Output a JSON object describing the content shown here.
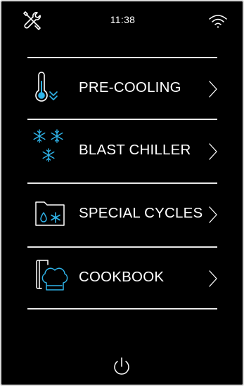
{
  "status_bar": {
    "time": "11:38",
    "left_icon": "tools-icon",
    "right_icon": "wifi-icon"
  },
  "menu": {
    "items": [
      {
        "label": "PRE-COOLING",
        "icon": "thermometer-down-icon"
      },
      {
        "label": "BLAST CHILLER",
        "icon": "snowflakes-icon"
      },
      {
        "label": "SPECIAL CYCLES",
        "icon": "special-cycles-folder-icon"
      },
      {
        "label": "COOKBOOK",
        "icon": "cookbook-chef-hat-icon"
      }
    ],
    "chevron_icon": "chevron-right-icon"
  },
  "footer": {
    "power_icon": "power-icon"
  },
  "colors": {
    "background": "#000000",
    "text": "#ffffff",
    "accent": "#2fb4ea",
    "bezel": "#d9d9d9"
  }
}
